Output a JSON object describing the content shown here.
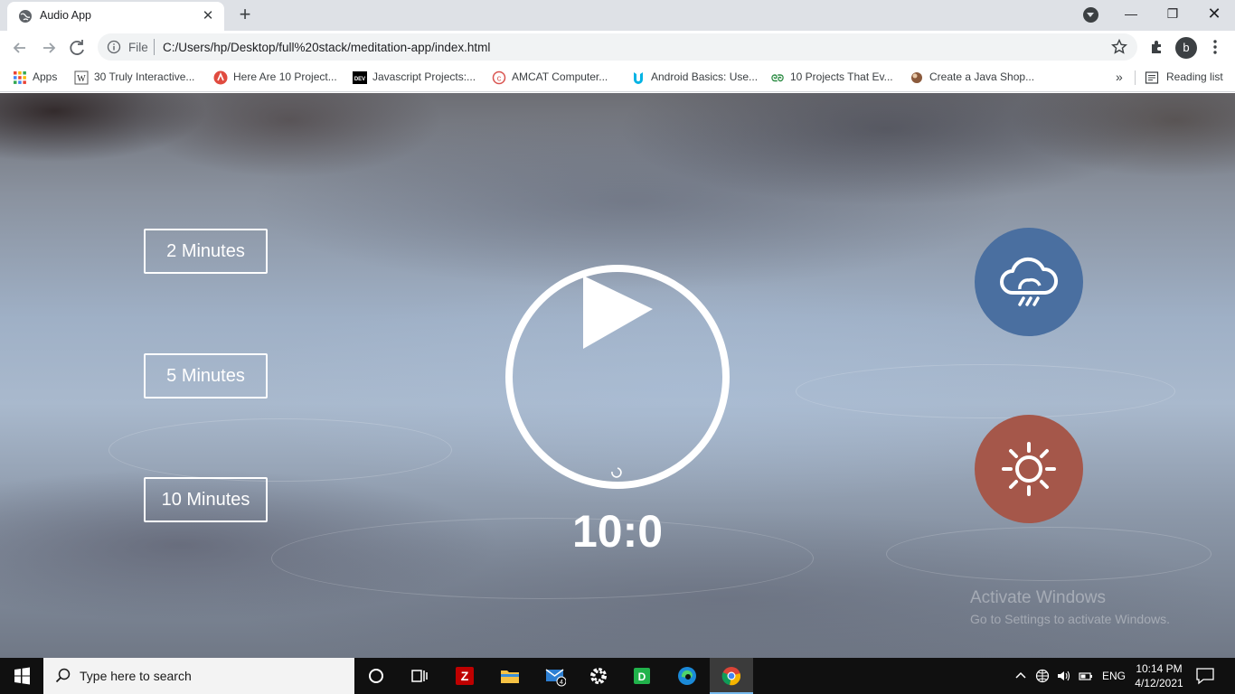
{
  "browser": {
    "tab_title": "Audio App",
    "url_scheme": "File",
    "url": "C:/Users/hp/Desktop/full%20stack/meditation-app/index.html",
    "profile_initial": "b",
    "bookmarks": [
      {
        "label": "Apps",
        "icon": "apps-grid-icon"
      },
      {
        "label": "30 Truly Interactive...",
        "icon": "w-site-icon"
      },
      {
        "label": "Here Are 10 Project...",
        "icon": "red-logo-icon"
      },
      {
        "label": "Javascript Projects:...",
        "icon": "dev-logo-icon"
      },
      {
        "label": "AMCAT Computer...",
        "icon": "amcat-logo-icon"
      },
      {
        "label": "Android Basics: Use...",
        "icon": "udacity-logo-icon"
      },
      {
        "label": "10 Projects That Ev...",
        "icon": "gfg-logo-icon"
      },
      {
        "label": "Create a Java Shop...",
        "icon": "coffee-logo-icon"
      }
    ],
    "more_bookmarks": "»",
    "reading_list": "Reading list"
  },
  "app": {
    "durations": [
      "2 Minutes",
      "5 Minutes",
      "10 Minutes"
    ],
    "timer": "10:0",
    "sounds": [
      {
        "name": "rain",
        "icon": "cloud-rain-icon",
        "color": "#4a6fa0"
      },
      {
        "name": "sun",
        "icon": "sun-icon",
        "color": "#a5574a"
      }
    ]
  },
  "watermark": {
    "line1": "Activate Windows",
    "line2": "Go to Settings to activate Windows."
  },
  "taskbar": {
    "search_placeholder": "Type here to search",
    "mail_badge": "4",
    "language": "ENG",
    "time": "10:14 PM",
    "date": "4/12/2021"
  }
}
